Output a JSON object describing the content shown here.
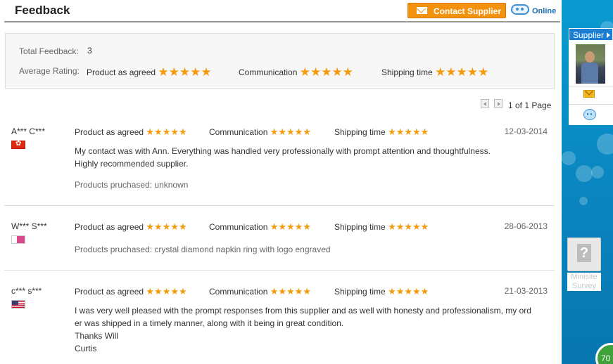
{
  "header": {
    "title": "Feedback",
    "contact_label": "Contact Supplier",
    "online_label": "Online"
  },
  "summary": {
    "total_label": "Total Feedback:",
    "total_value": "3",
    "avg_label": "Average Rating:",
    "ratings": [
      {
        "label": "Product as agreed",
        "stars": 5
      },
      {
        "label": "Communication",
        "stars": 5
      },
      {
        "label": "Shipping time",
        "stars": 5
      }
    ]
  },
  "pager": {
    "text": "1 of 1 Page"
  },
  "reviews": [
    {
      "user": "A*** C***",
      "flag": "hong-kong-flag",
      "ratings": [
        {
          "label": "Product as agreed",
          "stars": 5
        },
        {
          "label": "Communication",
          "stars": 5
        },
        {
          "label": "Shipping time",
          "stars": 5
        }
      ],
      "date": "12-03-2014",
      "comment_lines": [
        "My contact was with Ann. Everything was handled very professionally with prompt attention and thoughtfulness.",
        "Highly recommended supplier."
      ],
      "products": "Products pruchased: unknown"
    },
    {
      "user": "W*** S***",
      "flag": "pink-flag",
      "ratings": [
        {
          "label": "Product as agreed",
          "stars": 5
        },
        {
          "label": "Communication",
          "stars": 5
        },
        {
          "label": "Shipping time",
          "stars": 5
        }
      ],
      "date": "28-06-2013",
      "comment_lines": [],
      "products": "Products pruchased: crystal diamond napkin ring with logo engraved"
    },
    {
      "user": "c*** s***",
      "flag": "us-flag",
      "ratings": [
        {
          "label": "Product as agreed",
          "stars": 5
        },
        {
          "label": "Communication",
          "stars": 5
        },
        {
          "label": "Shipping time",
          "stars": 5
        }
      ],
      "date": "21-03-2013",
      "comment_lines": [
        "I was very well pleased with the prompt responses from this supplier and as well with honesty and professionalism, my ord",
        "er was shipped in a timely manner, along with it being in great condition.",
        "Thanks Will",
        "Curtis"
      ],
      "products": ""
    }
  ],
  "sidebar": {
    "supplier_label": "Supplier",
    "survey_line1": "Minisite",
    "survey_line2": "Survey",
    "score": "70"
  },
  "icons": {
    "star": "★",
    "mail": "mail-icon",
    "chat": "chat-icon"
  },
  "colors": {
    "star": "#f59a0c",
    "contact_button": "#f3920f",
    "online_text": "#1a6fb8",
    "side_panel": "#0a86c0"
  }
}
